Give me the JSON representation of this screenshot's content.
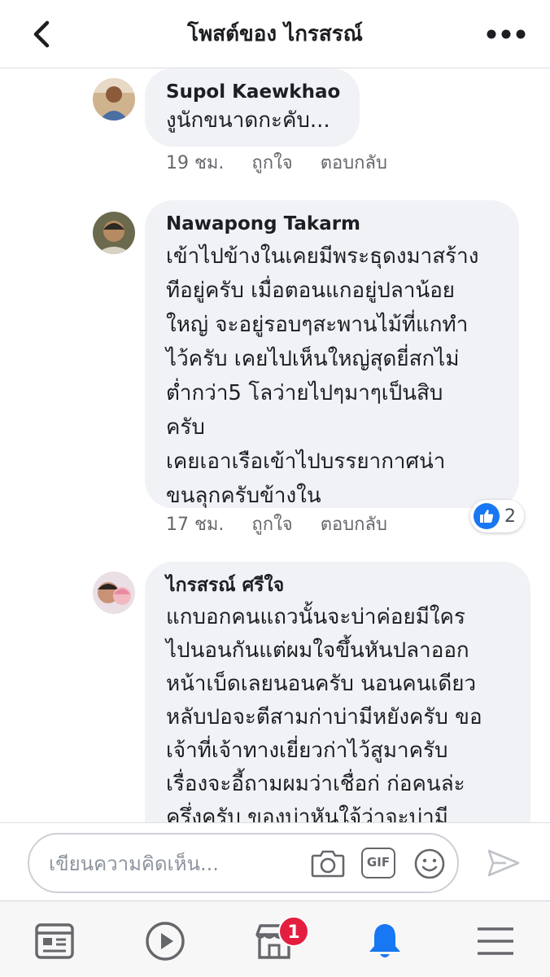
{
  "header": {
    "title": "โพสต์ของ ไกรสรณ์",
    "back_icon": "chevron-left-icon",
    "more_icon": "more-horizontal-icon"
  },
  "comments": [
    {
      "author": "Supol Kaewkhao",
      "text": "งูนักขนาดกะคับ...",
      "time": "19 ชม.",
      "like_label": "ถูกใจ",
      "reply_label": "ตอบกลับ"
    },
    {
      "author": "Nawapong Takarm",
      "text": "เข้าไปข้างในเคยมีพระธุดงมาสร้าง\nทีอยู่ครับ เมื่อตอนแกอยู่ปลาน้อย\nใหญ่ จะอยู่รอบๆสะพานไม้ที่แกทำ\nไว้ครับ เคยไปเห็นใหญ่สุดยี่สกไม่\nต่ำกว่า5 โลว่ายไปๆมาๆเป็นสิบ\nครับ\nเคยเอาเรือเข้าไปบรรยากาศน่า\nขนลุกครับข้างใน",
      "time": "17 ชม.",
      "like_label": "ถูกใจ",
      "reply_label": "ตอบกลับ",
      "reaction_count": "2"
    },
    {
      "author": "ไกรสรณ์ ศรีใจ",
      "text": "แกบอกคนแถวนั้นจะบ่าค่อยมีใคร\nไปนอนกันแต่ผมใจขึ้นหันปลาออก\nหน้าเบ็ดเลยนอนครับ นอนคนเดียว\nหลับปอจะตีสามก่าบ่ามีหยังครับ ขอ\nเจ้าที่เจ้าทางเยี่ยวก่าไว้สูมาครับ\nเรื่องจะอี้ถามผมว่าเชื่อก่ ก่อคนล่ะ\nครึ่งครับ ของบ่าหันใจ้ว่าจะบ่ามี"
    }
  ],
  "composer": {
    "placeholder": "เขียนความคิดเห็น...",
    "gif_label": "GIF"
  },
  "tabbar": {
    "marketplace_badge": "1",
    "active_color": "#1877f2"
  }
}
